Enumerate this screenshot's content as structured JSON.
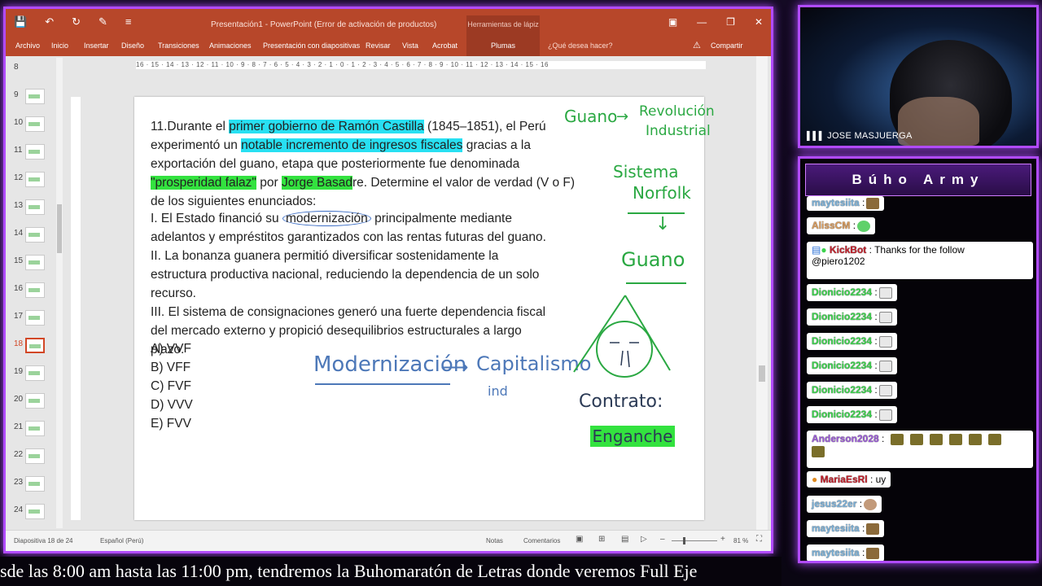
{
  "ppt": {
    "title": "Presentación1 - PowerPoint (Error de activación de productos)",
    "tools_group": "Herramientas de lápiz",
    "tabs": [
      "Archivo",
      "Inicio",
      "Insertar",
      "Diseño",
      "Transiciones",
      "Animaciones",
      "Presentación con diapositivas",
      "Revisar",
      "Vista",
      "Acrobat"
    ],
    "active_tab": "Plumas",
    "tell_me": "¿Qué desea hacer?",
    "share": "Compartir",
    "ruler_h": "16 · 15 · 14 · 13 · 12 · 11 · 10 · 9 · 8 · 7 · 6 · 5 · 4 · 3 · 2 · 1 · 0 · 1 · 2 · 3 · 4 · 5 · 6 · 7 · 8 · 9 · 10 · 11 · 12 · 13 · 14 · 15 · 16",
    "thumbs": [
      "8",
      "9",
      "10",
      "11",
      "12",
      "13",
      "14",
      "15",
      "16",
      "17",
      "18",
      "19",
      "20",
      "21",
      "22",
      "23",
      "24"
    ],
    "active_thumb": "18",
    "status": {
      "slide_info": "Diapositiva 18 de 24",
      "language": "Español (Perú)",
      "notes": "Notas",
      "comments": "Comentarios",
      "zoom": "81 %"
    }
  },
  "slide": {
    "q_prefix": "11.Durante el ",
    "q_hl1": "primer gobierno de Ramón Castilla",
    "q_mid1": " (1845–1851), el Perú experimentó un ",
    "q_hl2": "notable incremento de ingresos fiscales",
    "q_mid2": " gracias a la exportación del guano, etapa que posteriormente fue denominada ",
    "q_hl3": "\"prosperidad falaz\"",
    "q_mid3": " por ",
    "q_hl4": "Jorge Basad",
    "q_end": "re. Determine el valor de verdad (V o F) de los siguientes enunciados:",
    "s1_pre": "I. El Estado financió su ",
    "s1_circ": "modernización",
    "s1_post": " principalmente mediante adelantos y empréstitos garantizados con las rentas futuras del guano.",
    "s2": "II. La bonanza guanera permitió diversificar sostenidamente la estructura productiva nacional, reduciendo la dependencia de un solo recurso.",
    "s3": "III. El sistema de consignaciones generó una fuerte dependencia fiscal del mercado externo y propició desequilibrios estructurales a largo plazo.",
    "options": [
      "A) VVF",
      "B) VFF",
      "C) FVF",
      "D) VVV",
      "E) FVV"
    ],
    "ink": {
      "guano1": "Guano",
      "revolucion": "Revolución",
      "industrial": "Industrial",
      "sistema": "Sistema",
      "norfolk": "Norfolk",
      "guano2": "Guano",
      "modernizacion": "Modernización",
      "capitalismo": "Capitalismo",
      "ind": "ind",
      "contrato": "Contrato:",
      "enganche": "Enganche"
    }
  },
  "stream": {
    "cam_name": "JOSE MASJUERGA",
    "chat_title": "Búho Army",
    "messages": [
      {
        "user": "maytesiita",
        "text": ":"
      },
      {
        "user": "AlissCM",
        "text": ":"
      },
      {
        "user": "KickBot",
        "text": ": Thanks for the follow",
        "line2": "@piero1202"
      },
      {
        "user": "Dionicio2234",
        "text": ":"
      },
      {
        "user": "Dionicio2234",
        "text": ":"
      },
      {
        "user": "Dionicio2234",
        "text": ":"
      },
      {
        "user": "Dionicio2234",
        "text": ":"
      },
      {
        "user": "Dionicio2234",
        "text": ":"
      },
      {
        "user": "Dionicio2234",
        "text": ":"
      },
      {
        "user": "Anderson2028",
        "text": ":"
      },
      {
        "user": "MariaEsRl",
        "text": ": uy"
      },
      {
        "user": "jesus22er",
        "text": ":"
      },
      {
        "user": "maytesiita",
        "text": ":"
      },
      {
        "user": "maytesiita",
        "text": ":"
      }
    ],
    "ticker": "sde las 8:00 am hasta las 11:00 pm, tendremos la Buhomaratón de Letras donde veremos Full Eje"
  }
}
